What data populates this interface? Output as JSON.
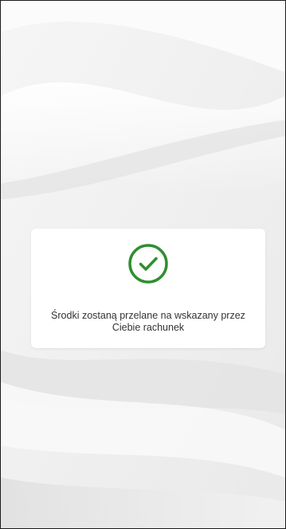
{
  "dialog": {
    "icon": "check-circle-icon",
    "icon_color": "#2e8f2e",
    "message_line1": "Środki zostaną przelane na wskazany przez",
    "message_line2": "Ciebie rachunek"
  },
  "colors": {
    "background": "#f1f1f1",
    "card": "#ffffff",
    "text": "#333333",
    "accent": "#2e8f2e"
  }
}
